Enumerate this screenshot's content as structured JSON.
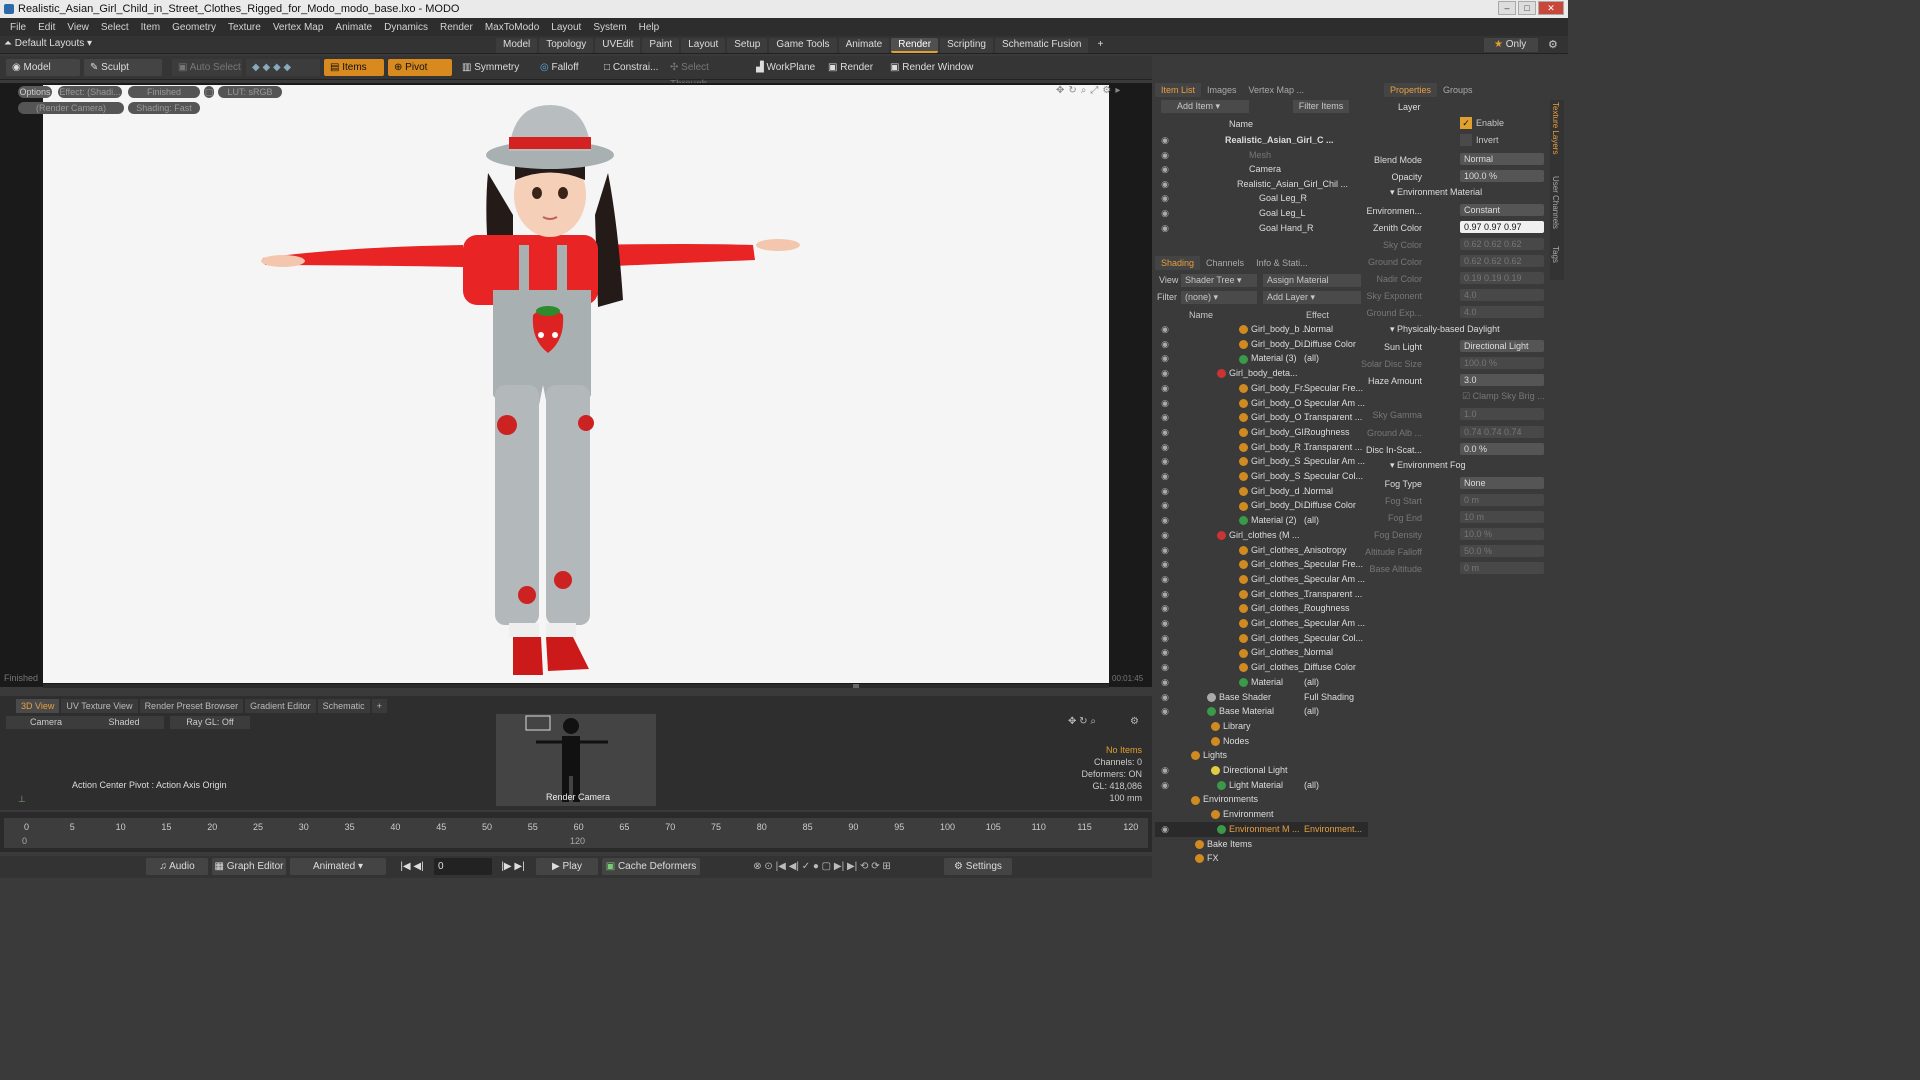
{
  "window": {
    "title": "Realistic_Asian_Girl_Child_in_Street_Clothes_Rigged_for_Modo_modo_base.lxo - MODO"
  },
  "menu": [
    "File",
    "Edit",
    "View",
    "Select",
    "Item",
    "Geometry",
    "Texture",
    "Vertex Map",
    "Animate",
    "Dynamics",
    "Render",
    "MaxToModo",
    "Layout",
    "System",
    "Help"
  ],
  "layouts": {
    "dropdown": "Default Layouts",
    "tabs": [
      "Model",
      "Topology",
      "UVEdit",
      "Paint",
      "Layout",
      "Setup",
      "Game Tools",
      "Animate",
      "Render",
      "Scripting",
      "Schematic Fusion"
    ],
    "active": "Render",
    "only": "Only"
  },
  "toolbar": {
    "model": "Model",
    "sculpt": "Sculpt",
    "auto_select": "Auto Select",
    "items": "Items",
    "pivot": "Pivot",
    "symmetry": "Symmetry",
    "falloff": "Falloff",
    "constrain": "Constrai...",
    "select_through": "Select Through",
    "workplane": "WorkPlane",
    "render": "Render",
    "render_window": "Render Window"
  },
  "viewport": {
    "options": "Options",
    "effect": "Effect: (Shadi...",
    "finished_pill": "Finished",
    "lut": "LUT: sRGB",
    "camera": "(Render Camera)",
    "shading": "Shading: Fast",
    "status": "Finished",
    "time": "00:01:45"
  },
  "bottom": {
    "tabs": [
      "3D View",
      "UV Texture View",
      "Render Preset Browser",
      "Gradient Editor",
      "Schematic"
    ],
    "camera": "Camera",
    "shaded": "Shaded",
    "raygl": "Ray GL: Off",
    "action_center": "Action Center Pivot : Action Axis Origin",
    "render_camera": "Render Camera",
    "info": {
      "no_items": "No Items",
      "channels": "Channels: 0",
      "deformers": "Deformers: ON",
      "gl": "GL: 418,086",
      "mm": "100 mm"
    }
  },
  "timeline": {
    "ticks": [
      "0",
      "5",
      "10",
      "15",
      "20",
      "25",
      "30",
      "35",
      "40",
      "45",
      "50",
      "55",
      "60",
      "65",
      "70",
      "75",
      "80",
      "85",
      "90",
      "95",
      "100",
      "105",
      "110",
      "115",
      "120"
    ],
    "start": "0",
    "mid": "120"
  },
  "transport": {
    "audio": "Audio",
    "graph_editor": "Graph Editor",
    "animated": "Animated",
    "frame": "0",
    "play": "Play",
    "cache_deformers": "Cache Deformers",
    "settings": "Settings"
  },
  "item_list": {
    "tabs": [
      "Item List",
      "Images",
      "Vertex Map ..."
    ],
    "add_item": "Add Item",
    "filter": "Filter Items",
    "col_name": "Name",
    "rows": [
      "Realistic_Asian_Girl_C ...",
      "Mesh",
      "Camera",
      "Realistic_Asian_Girl_Chil ...",
      "Goal Leg_R",
      "Goal Leg_L",
      "Goal Hand_R"
    ]
  },
  "shading": {
    "tabs": [
      "Shading",
      "Channels",
      "Info & Stati..."
    ],
    "view_label": "View",
    "view": "Shader Tree",
    "assign": "Assign Material",
    "filter_label": "Filter",
    "filter": "(none)",
    "add_layer": "Add Layer",
    "col_name": "Name",
    "col_effect": "Effect",
    "rows": [
      {
        "name": "Girl_body_b ...",
        "effect": "Normal"
      },
      {
        "name": "Girl_body_Di...",
        "effect": "Diffuse Color"
      },
      {
        "name": "Material (3)",
        "effect": "(all)"
      },
      {
        "name": "Girl_body_deta...",
        "effect": ""
      },
      {
        "name": "Girl_body_Fr...",
        "effect": "Specular Fre..."
      },
      {
        "name": "Girl_body_O ...",
        "effect": "Specular Am ..."
      },
      {
        "name": "Girl_body_O ...",
        "effect": "Transparent ..."
      },
      {
        "name": "Girl_body_Gl...",
        "effect": "Roughness"
      },
      {
        "name": "Girl_body_R ...",
        "effect": "Transparent ..."
      },
      {
        "name": "Girl_body_S ...",
        "effect": "Specular Am ..."
      },
      {
        "name": "Girl_body_S ...",
        "effect": "Specular Col..."
      },
      {
        "name": "Girl_body_d ...",
        "effect": "Normal"
      },
      {
        "name": "Girl_body_Di...",
        "effect": "Diffuse Color"
      },
      {
        "name": "Material (2)",
        "effect": "(all)"
      },
      {
        "name": "Girl_clothes (M ...",
        "effect": ""
      },
      {
        "name": "Girl_clothes_...",
        "effect": "Anisotropy"
      },
      {
        "name": "Girl_clothes_...",
        "effect": "Specular Fre..."
      },
      {
        "name": "Girl_clothes_...",
        "effect": "Specular Am ..."
      },
      {
        "name": "Girl_clothes_...",
        "effect": "Transparent ..."
      },
      {
        "name": "Girl_clothes_...",
        "effect": "Roughness"
      },
      {
        "name": "Girl_clothes_...",
        "effect": "Specular Am ..."
      },
      {
        "name": "Girl_clothes_...",
        "effect": "Specular Col..."
      },
      {
        "name": "Girl_clothes_...",
        "effect": "Normal"
      },
      {
        "name": "Girl_clothes_...",
        "effect": "Diffuse Color"
      },
      {
        "name": "Material",
        "effect": "(all)"
      },
      {
        "name": "Base Shader",
        "effect": "Full Shading"
      },
      {
        "name": "Base Material",
        "effect": "(all)"
      },
      {
        "name": "Library",
        "effect": ""
      },
      {
        "name": "Nodes",
        "effect": ""
      },
      {
        "name": "Lights",
        "effect": ""
      },
      {
        "name": "Directional Light",
        "effect": ""
      },
      {
        "name": "Light Material",
        "effect": "(all)"
      },
      {
        "name": "Environments",
        "effect": ""
      },
      {
        "name": "Environment",
        "effect": ""
      },
      {
        "name": "Environment M ...",
        "effect": "Environment..."
      },
      {
        "name": "Bake Items",
        "effect": ""
      },
      {
        "name": "FX",
        "effect": ""
      }
    ]
  },
  "properties": {
    "tabs": [
      "Properties",
      "Groups"
    ],
    "layer": "Layer",
    "enable": "Enable",
    "invert": "Invert",
    "side_tabs": [
      "Texture Layers",
      "User Channels",
      "Tags"
    ],
    "fields": [
      {
        "label": "Blend Mode",
        "value": "Normal"
      },
      {
        "label": "Opacity",
        "value": "100.0 %"
      },
      {
        "label": "Environmen...",
        "value": "Constant"
      },
      {
        "label": "Zenith Color",
        "value": "0.97 0.97 0.97"
      },
      {
        "label": "Sky Color",
        "value": "0.62 0.62 0.62"
      },
      {
        "label": "Ground Color",
        "value": "0.62 0.62 0.62"
      },
      {
        "label": "Nadir Color",
        "value": "0.19 0.19 0.19"
      },
      {
        "label": "Sky Exponent",
        "value": "4.0"
      },
      {
        "label": "Ground Exp...",
        "value": "4.0"
      },
      {
        "label": "Sun Light",
        "value": "Directional Light"
      },
      {
        "label": "Solar Disc Size",
        "value": "100.0 %"
      },
      {
        "label": "Haze Amount",
        "value": "3.0"
      },
      {
        "label": "Sky Gamma",
        "value": "1.0"
      },
      {
        "label": "Ground Alb ...",
        "value": "0.74 0.74 0.74"
      },
      {
        "label": "Disc In-Scat...",
        "value": "0.0 %"
      },
      {
        "label": "Fog Type",
        "value": "None"
      },
      {
        "label": "Fog Start",
        "value": "0 m"
      },
      {
        "label": "Fog End",
        "value": "10 m"
      },
      {
        "label": "Fog Density",
        "value": "10.0 %"
      },
      {
        "label": "Altitude Falloff",
        "value": "50.0 %"
      },
      {
        "label": "Base Altitude",
        "value": "0 m"
      }
    ],
    "sections": [
      "Environment Material",
      "Physically-based Daylight",
      "Environment Fog"
    ],
    "clamp": "Clamp Sky Brig ..."
  }
}
